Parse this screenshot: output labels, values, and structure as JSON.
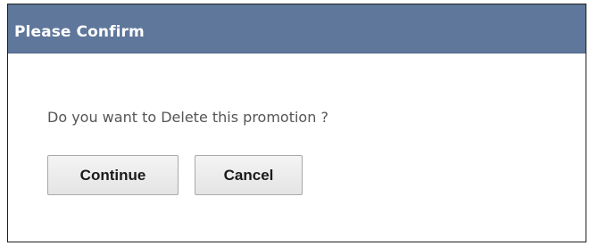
{
  "dialog": {
    "title": "Please Confirm",
    "message": "Do you want to Delete this promotion ?",
    "buttons": {
      "continue_label": "Continue",
      "cancel_label": "Cancel"
    }
  },
  "colors": {
    "titlebar": "#5f779b",
    "title_text": "#ffffff",
    "message_text": "#555555",
    "button_bg": "#eeeeee",
    "button_border": "#a9a9a9"
  }
}
